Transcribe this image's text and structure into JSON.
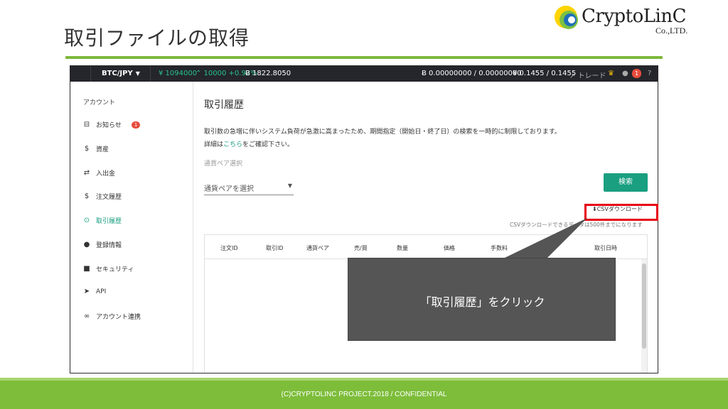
{
  "slide": {
    "title": "取引ファイルの取得",
    "footer": "(C)CRYPTOLINC PROJECT.2018 / CONFIDENTIAL",
    "accent_color": "#7db83a",
    "logo": {
      "name": "CryptoLinC",
      "sub": "Co.,LTD."
    }
  },
  "topbar": {
    "pair": "BTC/JPY",
    "price_jpy": "¥ 1094000",
    "change": "⌃ 10000 +0.92%",
    "btc_price": "Ƀ 1822.8050",
    "btc_balance": "Ƀ 0.00000000 / 0.00000000",
    "jpy_balance": "¥ 0.1455 / 0.1455",
    "trade_link": "トレード",
    "notif_count": "1"
  },
  "sidebar": {
    "heading": "アカウント",
    "items": [
      {
        "label": "お知らせ",
        "icon": "inbox-icon",
        "glyph": "⊟",
        "badge": "1"
      },
      {
        "label": "資産",
        "icon": "dollar-icon",
        "glyph": "$"
      },
      {
        "label": "入出金",
        "icon": "transfer-icon",
        "glyph": "⇄"
      },
      {
        "label": "注文履歴",
        "icon": "dollar-icon",
        "glyph": "$"
      },
      {
        "label": "取引履歴",
        "icon": "clock-icon",
        "glyph": "⊙"
      },
      {
        "label": "登録情報",
        "icon": "user-icon",
        "glyph": "●"
      },
      {
        "label": "セキュリティ",
        "icon": "lock-icon",
        "glyph": "■"
      },
      {
        "label": "API",
        "icon": "send-icon",
        "glyph": "➤"
      },
      {
        "label": "アカウント連携",
        "icon": "link-icon",
        "glyph": "∞"
      }
    ]
  },
  "main": {
    "title": "取引履歴",
    "notice_line1": "取引数の急増に伴いシステム負荷が急激に高まったため、期間指定（開始日・終了日）の検索を一時的に制限しております。",
    "notice_prefix": "詳細は",
    "notice_link": "こちら",
    "notice_suffix": "をご確認下さい。",
    "pair_label": "通貨ペア選択",
    "pair_placeholder": "通貨ペアを選択",
    "search_button": "検索",
    "csv_button": "CSVダウンロード",
    "csv_note": "CSVダウンロードできるデータは500件までになります",
    "columns": [
      "注文ID",
      "取引ID",
      "通貨ペア",
      "売/買",
      "数量",
      "価格",
      "手数料",
      "",
      "取引日時"
    ]
  },
  "callout": {
    "text": "「取引履歴」をクリック"
  }
}
